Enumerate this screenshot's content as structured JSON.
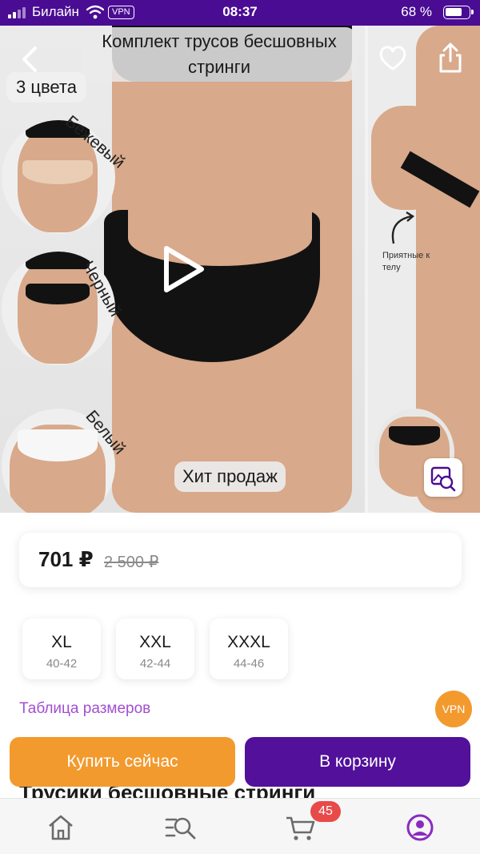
{
  "status_bar": {
    "carrier": "Билайн",
    "vpn": "VPN",
    "time": "08:37",
    "battery": "68 %"
  },
  "gallery": {
    "title": "Комплект трусов бесшовных стринги",
    "colors_count": "3 цвета",
    "swatches": [
      {
        "label": "Бежевый",
        "color": "#e9cdb4"
      },
      {
        "label": "Черный",
        "color": "#141414"
      },
      {
        "label": "Белый",
        "color": "#f7f7f7"
      }
    ],
    "badge": "Хит продаж",
    "side_note": "Приятные к телу"
  },
  "price": {
    "current": "701 ₽",
    "old": "2 500 ₽"
  },
  "sizes": [
    {
      "name": "XL",
      "range": "40-42"
    },
    {
      "name": "XXL",
      "range": "42-44"
    },
    {
      "name": "XXXL",
      "range": "44-46"
    }
  ],
  "size_table_link": "Таблица размеров",
  "vpn_badge": "VPN",
  "product_name_partial": "Трусики бесшовные стринги",
  "actions": {
    "buy_now": "Купить сейчас",
    "add_to_cart": "В корзину"
  },
  "tab_bar": {
    "items": [
      {
        "name": "home",
        "icon": "home-icon"
      },
      {
        "name": "catalog",
        "icon": "catalog-search-icon"
      },
      {
        "name": "cart",
        "icon": "cart-icon"
      },
      {
        "name": "profile",
        "icon": "profile-icon"
      }
    ],
    "cart_count": "45"
  },
  "colors": {
    "brand_purple": "#52109b",
    "accent_orange": "#f39a2e",
    "link_purple": "#a24fd0",
    "badge_red": "#e84a4a"
  }
}
